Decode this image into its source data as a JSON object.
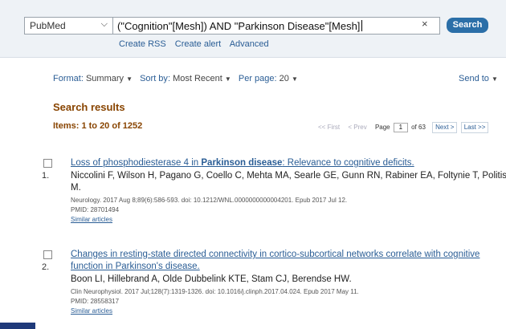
{
  "search": {
    "database": "PubMed",
    "query": "(\"Cognition\"[Mesh]) AND \"Parkinson Disease\"[Mesh]",
    "clear_symbol": "×",
    "search_label": "Search",
    "links": [
      "Create RSS",
      "Create alert",
      "Advanced"
    ]
  },
  "options": {
    "format_label": "Format",
    "format_value": "Summary",
    "sort_label": "Sort by",
    "sort_value": "Most Recent",
    "perpage_label": "Per page",
    "perpage_value": "20",
    "send_to": "Send to"
  },
  "results": {
    "heading": "Search results",
    "items_count": "Items: 1 to 20 of 1252"
  },
  "pager": {
    "first": "<< First",
    "prev": "< Prev",
    "page_label": "Page",
    "page_value": "1",
    "of_pages": "of 63",
    "next": "Next >",
    "last": "Last >>"
  },
  "articles": [
    {
      "number": "1.",
      "title_pre": "Loss of phosphodiesterase 4 in ",
      "title_bold": "Parkinson disease",
      "title_post": ": Relevance to cognitive deficits.",
      "authors": "Niccolini F, Wilson H, Pagano G, Coello C, Mehta MA, Searle GE, Gunn RN, Rabiner EA, Foltynie T, Politis M.",
      "citation": "Neurology. 2017 Aug 8;89(6):586-593. doi: 10.1212/WNL.0000000000004201. Epub 2017 Jul 12.",
      "pmid": "PMID: 28701494",
      "similar": "Similar articles"
    },
    {
      "number": "2.",
      "title_line1": "Changes in resting-state directed connectivity in cortico-subcortical networks correlate with cognitive",
      "title_line2": "function in Parkinson's disease.",
      "authors": "Boon LI, Hillebrand A, Olde Dubbelink KTE, Stam CJ, Berendse HW.",
      "citation": "Clin Neurophysiol. 2017 Jul;128(7):1319-1326. doi: 10.1016/j.clinph.2017.04.024. Epub 2017 May 11.",
      "pmid": "PMID: 28558317",
      "similar": "Similar articles"
    }
  ],
  "colors": {
    "link": "#2a5d95",
    "heading": "#884400",
    "search_button": "#2b6fa8"
  }
}
